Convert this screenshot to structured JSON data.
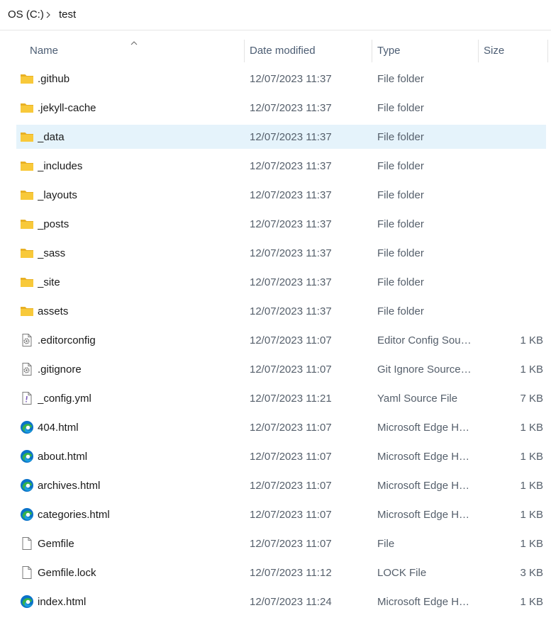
{
  "breadcrumb": {
    "root": "OS (C:)",
    "leaf": "test"
  },
  "columns": {
    "name": "Name",
    "date": "Date modified",
    "type": "Type",
    "size": "Size"
  },
  "colors": {
    "selected_row": "#e5f3fb",
    "folder": "#f8c93a",
    "edge_blue": "#0a72c9",
    "edge_green": "#36b24a"
  },
  "files": [
    {
      "name": ".github",
      "date": "12/07/2023 11:37",
      "type": "File folder",
      "size": "",
      "icon": "folder-icon"
    },
    {
      "name": ".jekyll-cache",
      "date": "12/07/2023 11:37",
      "type": "File folder",
      "size": "",
      "icon": "folder-icon"
    },
    {
      "name": "_data",
      "date": "12/07/2023 11:37",
      "type": "File folder",
      "size": "",
      "icon": "folder-icon",
      "selected": true
    },
    {
      "name": "_includes",
      "date": "12/07/2023 11:37",
      "type": "File folder",
      "size": "",
      "icon": "folder-icon"
    },
    {
      "name": "_layouts",
      "date": "12/07/2023 11:37",
      "type": "File folder",
      "size": "",
      "icon": "folder-icon"
    },
    {
      "name": "_posts",
      "date": "12/07/2023 11:37",
      "type": "File folder",
      "size": "",
      "icon": "folder-icon"
    },
    {
      "name": "_sass",
      "date": "12/07/2023 11:37",
      "type": "File folder",
      "size": "",
      "icon": "folder-icon"
    },
    {
      "name": "_site",
      "date": "12/07/2023 11:37",
      "type": "File folder",
      "size": "",
      "icon": "folder-icon"
    },
    {
      "name": "assets",
      "date": "12/07/2023 11:37",
      "type": "File folder",
      "size": "",
      "icon": "folder-icon"
    },
    {
      "name": ".editorconfig",
      "date": "12/07/2023 11:07",
      "type": "Editor Config Sour...",
      "size": "1 KB",
      "icon": "config-file-icon"
    },
    {
      "name": ".gitignore",
      "date": "12/07/2023 11:07",
      "type": "Git Ignore Source ...",
      "size": "1 KB",
      "icon": "config-file-icon"
    },
    {
      "name": "_config.yml",
      "date": "12/07/2023 11:21",
      "type": "Yaml Source File",
      "size": "7 KB",
      "icon": "yaml-file-icon"
    },
    {
      "name": "404.html",
      "date": "12/07/2023 11:07",
      "type": "Microsoft Edge HT...",
      "size": "1 KB",
      "icon": "edge-icon"
    },
    {
      "name": "about.html",
      "date": "12/07/2023 11:07",
      "type": "Microsoft Edge HT...",
      "size": "1 KB",
      "icon": "edge-icon"
    },
    {
      "name": "archives.html",
      "date": "12/07/2023 11:07",
      "type": "Microsoft Edge HT...",
      "size": "1 KB",
      "icon": "edge-icon"
    },
    {
      "name": "categories.html",
      "date": "12/07/2023 11:07",
      "type": "Microsoft Edge HT...",
      "size": "1 KB",
      "icon": "edge-icon"
    },
    {
      "name": "Gemfile",
      "date": "12/07/2023 11:07",
      "type": "File",
      "size": "1 KB",
      "icon": "blank-file-icon"
    },
    {
      "name": "Gemfile.lock",
      "date": "12/07/2023 11:12",
      "type": "LOCK File",
      "size": "3 KB",
      "icon": "blank-file-icon"
    },
    {
      "name": "index.html",
      "date": "12/07/2023 11:24",
      "type": "Microsoft Edge HT...",
      "size": "1 KB",
      "icon": "edge-icon"
    }
  ]
}
